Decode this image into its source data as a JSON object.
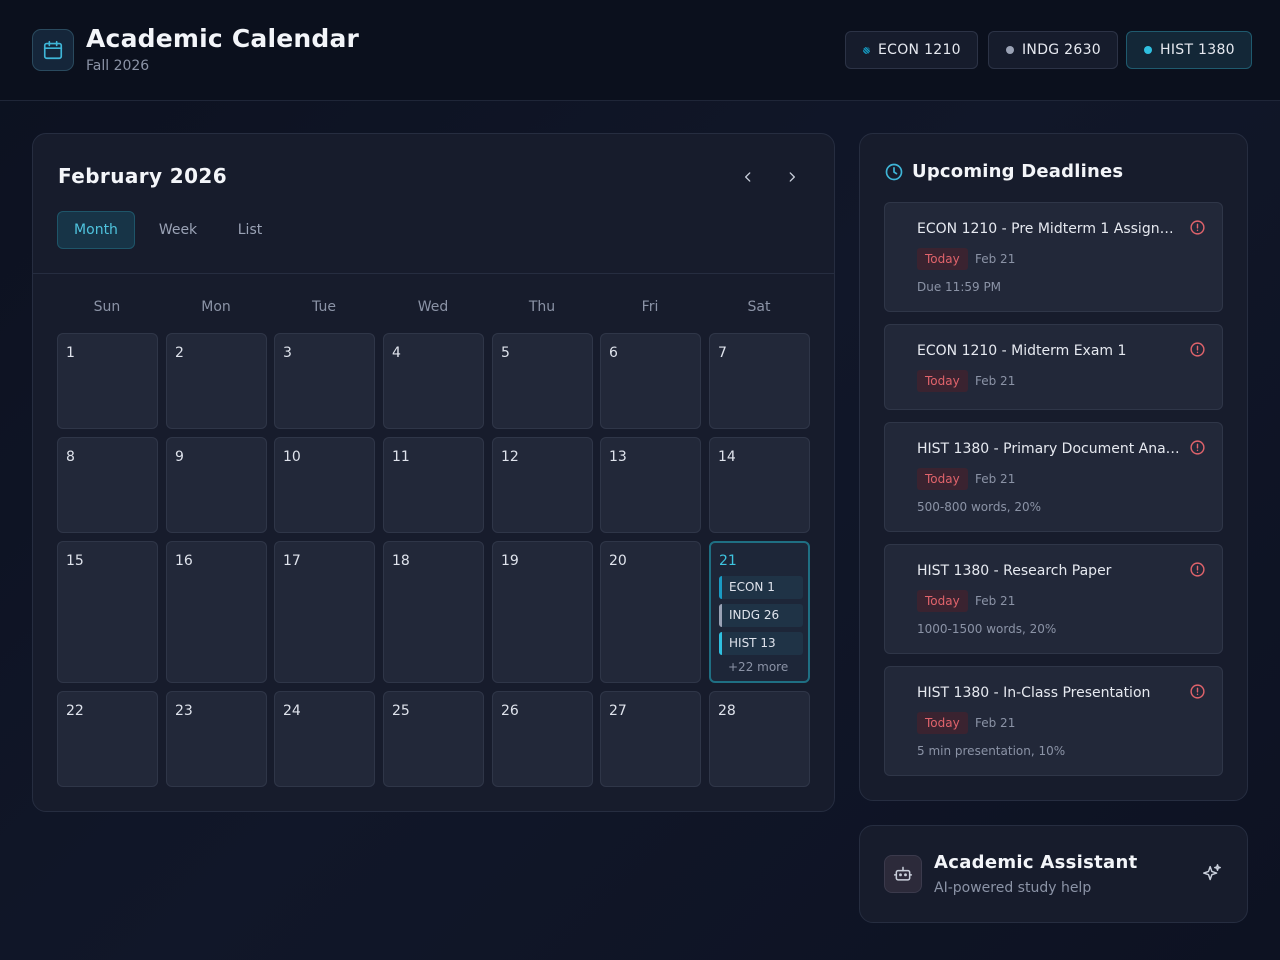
{
  "header": {
    "title": "Academic Calendar",
    "subtitle": "Fall 2026",
    "courses": [
      {
        "label": "ECON 1210",
        "color": "#1a9bc4"
      },
      {
        "label": "INDG 2630",
        "color": "#9aa2b5"
      },
      {
        "label": "HIST 1380",
        "color": "#2fc0e0"
      }
    ]
  },
  "calendar": {
    "month_label": "February 2026",
    "views": [
      "Month",
      "Week",
      "List"
    ],
    "active_view": "Month",
    "weekdays": [
      "Sun",
      "Mon",
      "Tue",
      "Wed",
      "Thu",
      "Fri",
      "Sat"
    ],
    "weeks": [
      [
        "1",
        "2",
        "3",
        "4",
        "5",
        "6",
        "7"
      ],
      [
        "8",
        "9",
        "10",
        "11",
        "12",
        "13",
        "14"
      ],
      [
        "15",
        "16",
        "17",
        "18",
        "19",
        "20",
        "21"
      ],
      [
        "22",
        "23",
        "24",
        "25",
        "26",
        "27",
        "28"
      ]
    ],
    "today": "21",
    "today_events": [
      {
        "label": "ECON 1",
        "color": "#1a9bc4"
      },
      {
        "label": "INDG 26",
        "color": "#9aa2b5"
      },
      {
        "label": "HIST 13",
        "color": "#2fc0e0"
      }
    ],
    "more_label": "+22 more"
  },
  "deadlines": {
    "title": "Upcoming Deadlines",
    "items": [
      {
        "name": "ECON 1210 - Pre Midterm 1 Assign…",
        "badge": "Today",
        "date": "Feb 21",
        "detail": "Due 11:59 PM"
      },
      {
        "name": "ECON 1210 - Midterm Exam 1",
        "badge": "Today",
        "date": "Feb 21",
        "detail": ""
      },
      {
        "name": "HIST 1380 - Primary Document Ana…",
        "badge": "Today",
        "date": "Feb 21",
        "detail": "500-800 words, 20%"
      },
      {
        "name": "HIST 1380 - Research Paper",
        "badge": "Today",
        "date": "Feb 21",
        "detail": "1000-1500 words, 20%"
      },
      {
        "name": "HIST 1380 - In-Class Presentation",
        "badge": "Today",
        "date": "Feb 21",
        "detail": "5 min presentation, 10%"
      }
    ]
  },
  "assistant": {
    "title": "Academic Assistant",
    "subtitle": "AI-powered study help"
  }
}
